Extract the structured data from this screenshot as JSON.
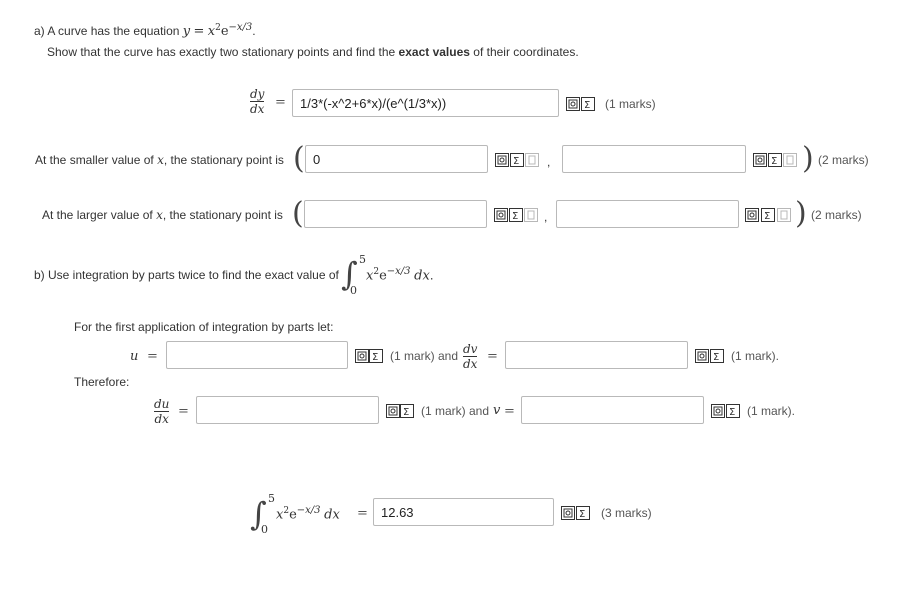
{
  "part_a": {
    "label": "a) A curve has the equation",
    "equation_y": "y",
    "equation_eq": "=",
    "equation_base": "x",
    "equation_base_exp": "2",
    "equation_e": "e",
    "equation_exp": "−x/3",
    "equation_end": ".",
    "instruction_pre": "Show that the curve has exactly two stationary points and find the",
    "instruction_bold": "exact values",
    "instruction_post": "of their coordinates.",
    "dydx_num": "dy",
    "dydx_den": "dx",
    "eq": "=",
    "dydx_value": "1/3*(-x^2+6*x)/(e^(1/3*x))",
    "dydx_marks": "(1 marks)",
    "smaller_pre": "At the smaller value of",
    "smaller_var": "x",
    "smaller_post": ", the stationary point is",
    "smaller_x_value": "0",
    "smaller_y_value": "",
    "smaller_marks": "(2 marks)",
    "larger_pre": "At the larger value of",
    "larger_var": "x",
    "larger_post": ", the stationary point is",
    "larger_x_value": "",
    "larger_y_value": "",
    "larger_marks": "(2 marks)",
    "open_paren": "(",
    "close_paren": ")",
    "comma": ","
  },
  "part_b": {
    "label": "b) Use integration by parts twice to find the exact value of",
    "int_upper": "5",
    "int_lower": "0",
    "int_body_base": "x",
    "int_body_exp": "2",
    "int_e": "e",
    "int_e_exp": "−x/3",
    "int_dx": "dx",
    "int_end": ".",
    "first_app": "For the first application of integration by parts let:",
    "u_var": "u",
    "u_value": "",
    "u_marks": "(1 mark) and",
    "dvdx_num": "dv",
    "dvdx_den": "dx",
    "dvdx_value": "",
    "dvdx_marks": "(1 mark).",
    "therefore": "Therefore:",
    "dudx_num": "du",
    "dudx_den": "dx",
    "dudx_value": "",
    "dudx_marks": "(1 mark) and",
    "v_var": "v",
    "v_value": "",
    "v_marks": "(1 mark).",
    "final_value": "12.63",
    "final_marks": "(3 marks)"
  },
  "icons": [
    "preview-icon",
    "sigma-icon",
    "answer-icon"
  ]
}
